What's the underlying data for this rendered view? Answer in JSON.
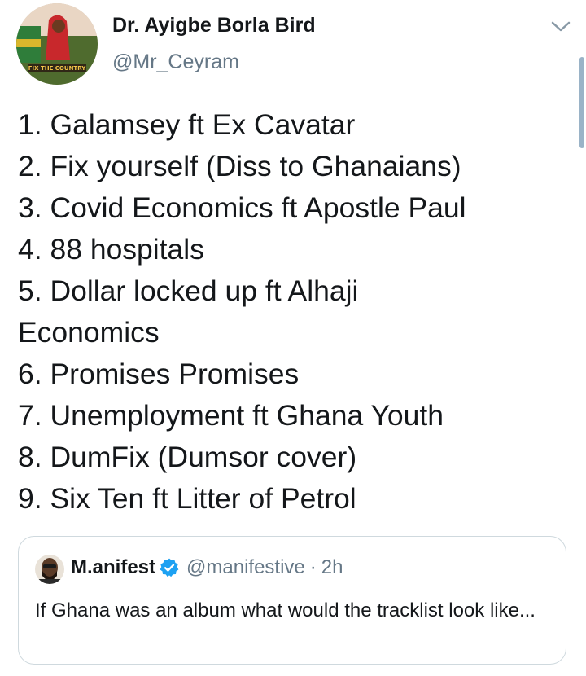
{
  "author": {
    "display_name": "Dr. Ayigbe Borla Bird",
    "handle": "@Mr_Ceyram"
  },
  "tweet": {
    "lines": [
      "1. Galamsey ft Ex Cavatar",
      "2. Fix yourself (Diss to Ghanaians)",
      "3. Covid Economics ft Apostle Paul",
      "4. 88 hospitals",
      "5. Dollar locked up ft Alhaji",
      "Economics",
      "6. Promises Promises",
      "7. Unemployment ft Ghana Youth",
      "8. DumFix (Dumsor cover)",
      "9. Six Ten ft Litter of Petrol"
    ]
  },
  "quoted_tweet": {
    "display_name": "M.anifest",
    "handle": "@manifestive",
    "separator": "·",
    "time": "2h",
    "text": "If Ghana was an album what would the tracklist look like..."
  },
  "icons": {
    "caret": "chevron-down-icon",
    "verified": "verified-badge-icon"
  },
  "colors": {
    "text_primary": "#14171a",
    "text_secondary": "#657786",
    "verified_blue": "#1da1f2",
    "border": "#cfd9de"
  }
}
